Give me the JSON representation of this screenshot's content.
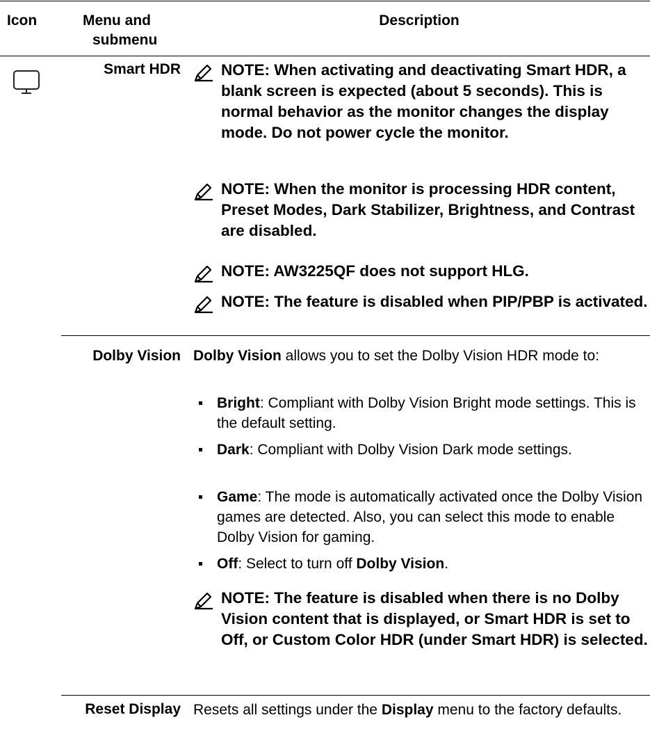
{
  "header": {
    "icon": "Icon",
    "menu_line1": "Menu and",
    "menu_line2": "submenu",
    "description": "Description"
  },
  "rows": {
    "smart_hdr": {
      "icon": "monitor-icon",
      "menu": "Smart HDR",
      "notes": [
        "NOTE: When activating and deactivating Smart HDR, a blank screen is expected (about 5 seconds). This is normal behavior as the monitor changes the display mode. Do not power cycle the monitor.",
        "NOTE: When the monitor is processing HDR content, Preset Modes, Dark Stabilizer, Brightness, and Contrast are disabled.",
        "NOTE: AW3225QF does not support HLG.",
        "NOTE: The feature is disabled when PIP/PBP is activated."
      ]
    },
    "dolby_vision": {
      "menu": "Dolby Vision",
      "intro_bold": "Dolby Vision",
      "intro_rest": " allows you to set the Dolby Vision HDR mode to:",
      "bullets": [
        {
          "bold": "Bright",
          "text": ": Compliant with Dolby Vision Bright mode settings. This is the default setting."
        },
        {
          "bold": "Dark",
          "text": ": Compliant with Dolby Vision Dark mode settings."
        },
        {
          "bold": "Game",
          "text": ": The mode is automatically activated once the Dolby Vision games are detected. Also, you can select this mode to enable Dolby Vision for gaming."
        },
        {
          "bold": "Off",
          "text": ": Select to turn off ",
          "bold2": "Dolby Vision",
          "tail": "."
        }
      ],
      "note": "NOTE: The feature is disabled when there is no Dolby Vision content that is displayed, or Smart HDR is set to Off, or Custom Color HDR (under Smart HDR) is selected."
    },
    "reset_display": {
      "menu": "Reset Display",
      "text_pre": "Resets all settings under the ",
      "text_bold": "Display",
      "text_post": " menu to the factory defaults."
    }
  },
  "icons": {
    "note": "note-pencil-icon",
    "bullet": "bullet-square-icon"
  }
}
